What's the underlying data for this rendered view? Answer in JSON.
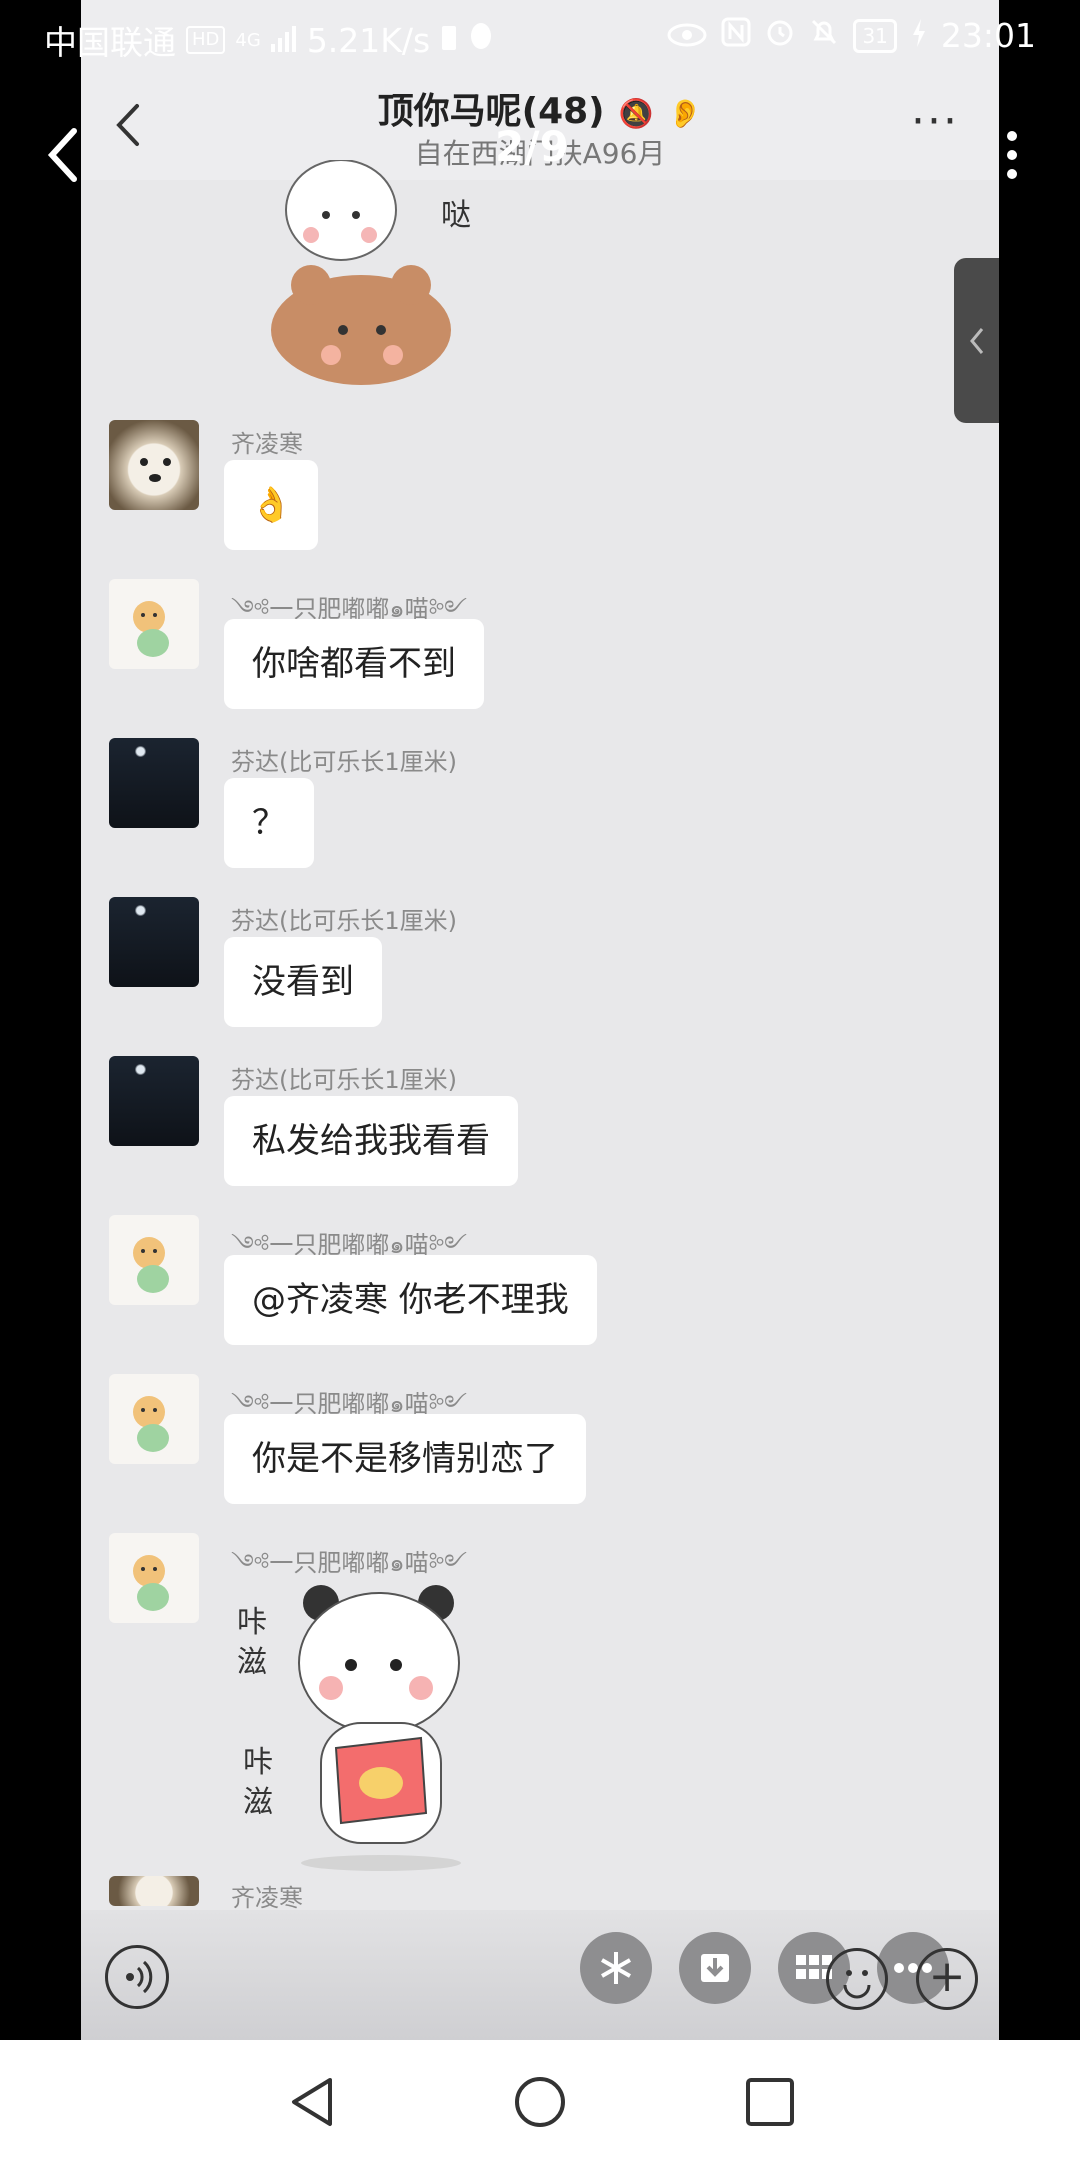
{
  "status_bar": {
    "carrier": "中国联通",
    "network_badge": "HD",
    "net_gen": "4G",
    "speed": "5.21K/s",
    "battery": "31",
    "time": "23:01"
  },
  "chat_header": {
    "title": "顶你马呢(48)",
    "subtitle": "自在西湖门扶A96月",
    "overlay_counter": "2/9"
  },
  "messages": [
    {
      "sender": "齐凌寒",
      "text": "👌",
      "avatar": "dog-avatar"
    },
    {
      "sender": "༺一只肥嘟嘟๑喵༻",
      "text": "你啥都看不到",
      "avatar": "cat-avatar"
    },
    {
      "sender": "芬达(比可乐长1厘米)",
      "text": "？",
      "avatar": "night-avatar"
    },
    {
      "sender": "芬达(比可乐长1厘米)",
      "text": "没看到",
      "avatar": "night-avatar"
    },
    {
      "sender": "芬达(比可乐长1厘米)",
      "text": "私发给我我看看",
      "avatar": "night-avatar"
    },
    {
      "sender": "༺一只肥嘟嘟๑喵༻",
      "text": "@齐凌寒  你老不理我",
      "avatar": "cat-avatar"
    },
    {
      "sender": "༺一只肥嘟嘟๑喵༻",
      "text": "你是不是移情别恋了",
      "avatar": "cat-avatar"
    },
    {
      "sender": "༺一只肥嘟嘟๑喵༻",
      "sticker_text": [
        "咔",
        "滋",
        "咔",
        "滋"
      ],
      "avatar": "cat-avatar"
    },
    {
      "sender": "齐凌寒",
      "avatar": "dog-avatar"
    }
  ],
  "top_sticker_text": "哒",
  "colors": {
    "chat_bg": "#e8e8ea",
    "bubble": "#ffffff",
    "name_gray": "#8a8a8a"
  }
}
